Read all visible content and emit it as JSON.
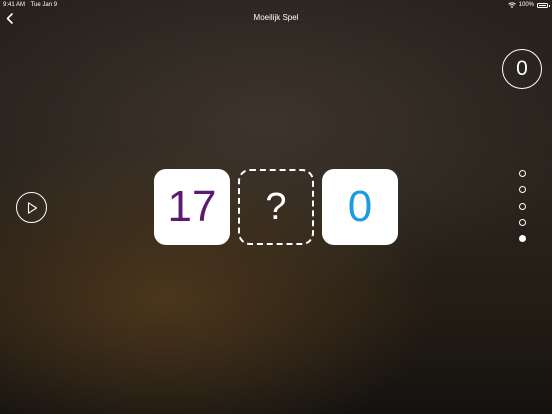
{
  "status_bar": {
    "time": "9:41 AM",
    "date": "Tue Jan 9",
    "battery": "100%"
  },
  "header": {
    "title": "Moeilijk Spel"
  },
  "score": {
    "value": "0"
  },
  "tiles": {
    "left": "17",
    "middle": "?",
    "right": "0"
  },
  "colors": {
    "left_number": "#5b1a6e",
    "right_number": "#1d9be0"
  },
  "progress": {
    "total": 5,
    "current": 5
  },
  "icons": {
    "back": "chevron-left-icon",
    "play": "play-icon",
    "wifi": "wifi-icon",
    "battery": "battery-icon"
  }
}
